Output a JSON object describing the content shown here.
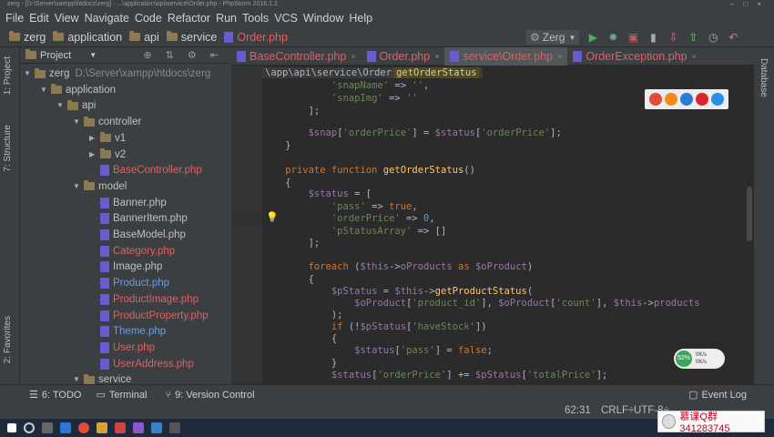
{
  "window": {
    "title": "zerg - [D:\\Server\\xampp\\htdocs\\zerg] - ...\\application\\api\\service\\Order.php - PhpStorm 2016.1.2"
  },
  "menu": [
    "File",
    "Edit",
    "View",
    "Navigate",
    "Code",
    "Refactor",
    "Run",
    "Tools",
    "VCS",
    "Window",
    "Help"
  ],
  "nav": {
    "crumbs": [
      "zerg",
      "application",
      "api",
      "service",
      "Order.php"
    ],
    "run_config": "Zerg"
  },
  "left_strip": {
    "project": "1: Project",
    "structure": "7: Structure",
    "favorites": "2: Favorites"
  },
  "right_strip": {
    "database": "Database"
  },
  "project_panel": {
    "header": "Project",
    "tree": [
      {
        "label": "zerg",
        "path": "D:\\Server\\xampp\\htdocs\\zerg",
        "indent": 0,
        "type": "folder",
        "open": true,
        "color": "norm"
      },
      {
        "label": "application",
        "indent": 1,
        "type": "folder",
        "open": true,
        "color": "norm"
      },
      {
        "label": "api",
        "indent": 2,
        "type": "folder",
        "open": true,
        "color": "norm"
      },
      {
        "label": "controller",
        "indent": 3,
        "type": "folder",
        "open": true,
        "color": "norm"
      },
      {
        "label": "v1",
        "indent": 4,
        "type": "folder",
        "open": false,
        "color": "norm"
      },
      {
        "label": "v2",
        "indent": 4,
        "type": "folder",
        "open": false,
        "color": "norm"
      },
      {
        "label": "BaseController.php",
        "indent": 4,
        "type": "php",
        "color": "red"
      },
      {
        "label": "model",
        "indent": 3,
        "type": "folder",
        "open": true,
        "color": "norm"
      },
      {
        "label": "Banner.php",
        "indent": 4,
        "type": "php",
        "color": "norm"
      },
      {
        "label": "BannerItem.php",
        "indent": 4,
        "type": "php",
        "color": "norm"
      },
      {
        "label": "BaseModel.php",
        "indent": 4,
        "type": "php",
        "color": "norm"
      },
      {
        "label": "Category.php",
        "indent": 4,
        "type": "php",
        "color": "red"
      },
      {
        "label": "Image.php",
        "indent": 4,
        "type": "php",
        "color": "norm"
      },
      {
        "label": "Product.php",
        "indent": 4,
        "type": "php",
        "color": "blue"
      },
      {
        "label": "ProductImage.php",
        "indent": 4,
        "type": "php",
        "color": "red"
      },
      {
        "label": "ProductProperty.php",
        "indent": 4,
        "type": "php",
        "color": "red"
      },
      {
        "label": "Theme.php",
        "indent": 4,
        "type": "php",
        "color": "blue"
      },
      {
        "label": "User.php",
        "indent": 4,
        "type": "php",
        "color": "red"
      },
      {
        "label": "UserAddress.php",
        "indent": 4,
        "type": "php",
        "color": "red"
      },
      {
        "label": "service",
        "indent": 3,
        "type": "folder",
        "open": true,
        "color": "norm"
      }
    ]
  },
  "tabs": [
    {
      "label": "BaseController.php",
      "active": false
    },
    {
      "label": "Order.php",
      "active": false
    },
    {
      "label": "service\\Order.php",
      "active": true
    },
    {
      "label": "OrderException.php",
      "active": false
    }
  ],
  "editor": {
    "breadcrumb_path": "\\app\\api\\service\\Order",
    "breadcrumb_fn": "getOrderStatus"
  },
  "tool_windows": {
    "todo": "6: TODO",
    "terminal": "Terminal",
    "vcs": "9: Version Control",
    "event_log": "Event Log"
  },
  "status": {
    "position": "62:31",
    "line_sep": "CRLF÷",
    "encoding": "UTF-8÷"
  },
  "network_widget": {
    "value": "52%",
    "up": "0K/s",
    "down": "0K/s"
  },
  "watermark": "慕课Q群341283745",
  "colors": {
    "bg": "#2b2b2b",
    "panel": "#3c3f41",
    "keyword": "#cc7832",
    "string": "#6a8759",
    "variable": "#9876aa",
    "function": "#ffc66d",
    "number": "#6897bb"
  }
}
